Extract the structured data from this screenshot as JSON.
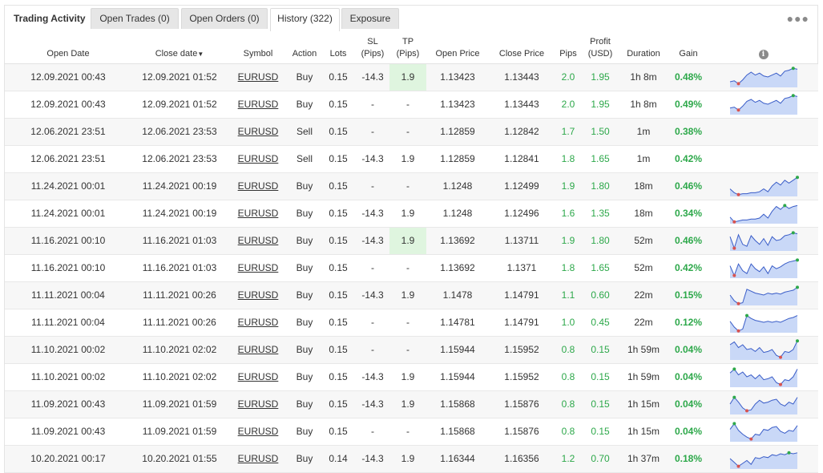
{
  "tabs": {
    "title": "Trading Activity",
    "items": [
      {
        "label": "Open Trades (0)"
      },
      {
        "label": "Open Orders (0)"
      },
      {
        "label": "History (322)"
      },
      {
        "label": "Exposure"
      }
    ],
    "active_index": 2
  },
  "more_icon": "ellipsis-icon",
  "columns": {
    "open_date": "Open Date",
    "close_date": "Close date",
    "sort_arrow": "▼",
    "symbol": "Symbol",
    "action": "Action",
    "lots": "Lots",
    "sl_1": "SL",
    "sl_2": "(Pips)",
    "tp_1": "TP",
    "tp_2": "(Pips)",
    "open_price": "Open Price",
    "close_price": "Close Price",
    "pips": "Pips",
    "profit_1": "Profit",
    "profit_2": "(USD)",
    "duration": "Duration",
    "gain": "Gain",
    "info": "i"
  },
  "colors": {
    "positive": "#2da84a",
    "tp_highlight": "#dff5df",
    "spark_fill": "#c9d8f7",
    "spark_line": "#3a5dc8",
    "spark_max": "#2da84a",
    "spark_min": "#d9534f"
  },
  "rows": [
    {
      "open_date": "12.09.2021 00:43",
      "close_date": "12.09.2021 01:52",
      "symbol": "EURUSD",
      "action": "Buy",
      "lots": "0.15",
      "sl": "-14.3",
      "tp": "1.9",
      "tp_hit": true,
      "open_price": "1.13423",
      "close_price": "1.13443",
      "pips": "2.0",
      "profit": "1.95",
      "duration": "1h 8m",
      "gain": "0.48%",
      "spark": [
        0.25,
        0.3,
        0.15,
        0.35,
        0.6,
        0.75,
        0.6,
        0.7,
        0.55,
        0.5,
        0.6,
        0.7,
        0.55,
        0.8,
        0.85,
        0.95,
        0.9
      ]
    },
    {
      "open_date": "12.09.2021 00:43",
      "close_date": "12.09.2021 01:52",
      "symbol": "EURUSD",
      "action": "Buy",
      "lots": "0.15",
      "sl": "-",
      "tp": "-",
      "tp_hit": false,
      "open_price": "1.13423",
      "close_price": "1.13443",
      "pips": "2.0",
      "profit": "1.95",
      "duration": "1h 8m",
      "gain": "0.49%",
      "spark": [
        0.3,
        0.35,
        0.2,
        0.4,
        0.65,
        0.75,
        0.6,
        0.7,
        0.55,
        0.5,
        0.6,
        0.7,
        0.55,
        0.8,
        0.85,
        0.95,
        0.9
      ]
    },
    {
      "open_date": "12.06.2021 23:51",
      "close_date": "12.06.2021 23:53",
      "symbol": "EURUSD",
      "action": "Sell",
      "lots": "0.15",
      "sl": "-",
      "tp": "-",
      "tp_hit": false,
      "open_price": "1.12859",
      "close_price": "1.12842",
      "pips": "1.7",
      "profit": "1.50",
      "duration": "1m",
      "gain": "0.38%",
      "spark": []
    },
    {
      "open_date": "12.06.2021 23:51",
      "close_date": "12.06.2021 23:53",
      "symbol": "EURUSD",
      "action": "Sell",
      "lots": "0.15",
      "sl": "-14.3",
      "tp": "1.9",
      "tp_hit": false,
      "open_price": "1.12859",
      "close_price": "1.12841",
      "pips": "1.8",
      "profit": "1.65",
      "duration": "1m",
      "gain": "0.42%",
      "spark": []
    },
    {
      "open_date": "11.24.2021 00:01",
      "close_date": "11.24.2021 00:19",
      "symbol": "EURUSD",
      "action": "Buy",
      "lots": "0.15",
      "sl": "-",
      "tp": "-",
      "tp_hit": false,
      "open_price": "1.1248",
      "close_price": "1.12499",
      "pips": "1.9",
      "profit": "1.80",
      "duration": "18m",
      "gain": "0.46%",
      "spark": [
        0.35,
        0.15,
        0.05,
        0.1,
        0.1,
        0.15,
        0.15,
        0.2,
        0.35,
        0.2,
        0.5,
        0.7,
        0.55,
        0.8,
        0.65,
        0.8,
        0.95
      ]
    },
    {
      "open_date": "11.24.2021 00:01",
      "close_date": "11.24.2021 00:19",
      "symbol": "EURUSD",
      "action": "Buy",
      "lots": "0.15",
      "sl": "-14.3",
      "tp": "1.9",
      "tp_hit": false,
      "open_price": "1.1248",
      "close_price": "1.12496",
      "pips": "1.6",
      "profit": "1.35",
      "duration": "18m",
      "gain": "0.34%",
      "spark": [
        0.3,
        0.05,
        0.1,
        0.15,
        0.15,
        0.2,
        0.2,
        0.25,
        0.45,
        0.25,
        0.6,
        0.85,
        0.7,
        0.9,
        0.75,
        0.85,
        0.9
      ]
    },
    {
      "open_date": "11.16.2021 00:10",
      "close_date": "11.16.2021 01:03",
      "symbol": "EURUSD",
      "action": "Buy",
      "lots": "0.15",
      "sl": "-14.3",
      "tp": "1.9",
      "tp_hit": true,
      "open_price": "1.13692",
      "close_price": "1.13711",
      "pips": "1.9",
      "profit": "1.80",
      "duration": "52m",
      "gain": "0.46%",
      "spark": [
        0.7,
        0.1,
        0.8,
        0.3,
        0.2,
        0.75,
        0.5,
        0.3,
        0.6,
        0.25,
        0.7,
        0.5,
        0.55,
        0.75,
        0.8,
        0.9,
        0.85
      ]
    },
    {
      "open_date": "11.16.2021 00:10",
      "close_date": "11.16.2021 01:03",
      "symbol": "EURUSD",
      "action": "Buy",
      "lots": "0.15",
      "sl": "-",
      "tp": "-",
      "tp_hit": false,
      "open_price": "1.13692",
      "close_price": "1.1371",
      "pips": "1.8",
      "profit": "1.65",
      "duration": "52m",
      "gain": "0.42%",
      "spark": [
        0.6,
        0.1,
        0.7,
        0.35,
        0.2,
        0.7,
        0.45,
        0.3,
        0.55,
        0.2,
        0.6,
        0.45,
        0.55,
        0.7,
        0.8,
        0.85,
        0.9
      ]
    },
    {
      "open_date": "11.11.2021 00:04",
      "close_date": "11.11.2021 00:26",
      "symbol": "EURUSD",
      "action": "Buy",
      "lots": "0.15",
      "sl": "-14.3",
      "tp": "1.9",
      "tp_hit": false,
      "open_price": "1.1478",
      "close_price": "1.14791",
      "pips": "1.1",
      "profit": "0.60",
      "duration": "22m",
      "gain": "0.15%",
      "spark": [
        0.5,
        0.2,
        0.05,
        0.1,
        0.8,
        0.7,
        0.6,
        0.55,
        0.5,
        0.6,
        0.55,
        0.6,
        0.55,
        0.65,
        0.7,
        0.75,
        0.9
      ]
    },
    {
      "open_date": "11.11.2021 00:04",
      "close_date": "11.11.2021 00:26",
      "symbol": "EURUSD",
      "action": "Buy",
      "lots": "0.15",
      "sl": "-",
      "tp": "-",
      "tp_hit": false,
      "open_price": "1.14781",
      "close_price": "1.14791",
      "pips": "1.0",
      "profit": "0.45",
      "duration": "22m",
      "gain": "0.12%",
      "spark": [
        0.55,
        0.25,
        0.05,
        0.15,
        0.85,
        0.7,
        0.6,
        0.55,
        0.5,
        0.55,
        0.5,
        0.55,
        0.5,
        0.6,
        0.7,
        0.75,
        0.85
      ]
    },
    {
      "open_date": "11.10.2021 00:02",
      "close_date": "11.10.2021 02:02",
      "symbol": "EURUSD",
      "action": "Buy",
      "lots": "0.15",
      "sl": "-",
      "tp": "-",
      "tp_hit": false,
      "open_price": "1.15944",
      "close_price": "1.15952",
      "pips": "0.8",
      "profit": "0.15",
      "duration": "1h 59m",
      "gain": "0.04%",
      "spark": [
        0.75,
        0.9,
        0.6,
        0.75,
        0.5,
        0.55,
        0.4,
        0.6,
        0.35,
        0.4,
        0.5,
        0.2,
        0.1,
        0.4,
        0.35,
        0.5,
        0.95
      ]
    },
    {
      "open_date": "11.10.2021 00:02",
      "close_date": "11.10.2021 02:02",
      "symbol": "EURUSD",
      "action": "Buy",
      "lots": "0.15",
      "sl": "-14.3",
      "tp": "1.9",
      "tp_hit": false,
      "open_price": "1.15944",
      "close_price": "1.15952",
      "pips": "0.8",
      "profit": "0.15",
      "duration": "1h 59m",
      "gain": "0.04%",
      "spark": [
        0.7,
        0.9,
        0.6,
        0.75,
        0.5,
        0.6,
        0.4,
        0.6,
        0.35,
        0.4,
        0.5,
        0.2,
        0.1,
        0.35,
        0.3,
        0.5,
        0.9
      ]
    },
    {
      "open_date": "11.09.2021 00:43",
      "close_date": "11.09.2021 01:59",
      "symbol": "EURUSD",
      "action": "Buy",
      "lots": "0.15",
      "sl": "-14.3",
      "tp": "1.9",
      "tp_hit": false,
      "open_price": "1.15868",
      "close_price": "1.15876",
      "pips": "0.8",
      "profit": "0.15",
      "duration": "1h 15m",
      "gain": "0.04%",
      "spark": [
        0.5,
        0.85,
        0.6,
        0.3,
        0.15,
        0.2,
        0.5,
        0.7,
        0.55,
        0.6,
        0.7,
        0.75,
        0.5,
        0.4,
        0.6,
        0.5,
        0.85
      ]
    },
    {
      "open_date": "11.09.2021 00:43",
      "close_date": "11.09.2021 01:59",
      "symbol": "EURUSD",
      "action": "Buy",
      "lots": "0.15",
      "sl": "-",
      "tp": "-",
      "tp_hit": false,
      "open_price": "1.15868",
      "close_price": "1.15876",
      "pips": "0.8",
      "profit": "0.15",
      "duration": "1h 15m",
      "gain": "0.04%",
      "spark": [
        0.6,
        0.9,
        0.55,
        0.35,
        0.2,
        0.1,
        0.35,
        0.3,
        0.6,
        0.55,
        0.7,
        0.75,
        0.5,
        0.4,
        0.55,
        0.5,
        0.8
      ]
    },
    {
      "open_date": "10.20.2021 00:17",
      "close_date": "10.20.2021 01:55",
      "symbol": "EURUSD",
      "action": "Buy",
      "lots": "0.14",
      "sl": "-14.3",
      "tp": "1.9",
      "tp_hit": false,
      "open_price": "1.16344",
      "close_price": "1.16356",
      "pips": "1.2",
      "profit": "0.70",
      "duration": "1h 37m",
      "gain": "0.18%",
      "spark": [
        0.5,
        0.3,
        0.1,
        0.25,
        0.4,
        0.2,
        0.55,
        0.5,
        0.6,
        0.55,
        0.7,
        0.65,
        0.75,
        0.7,
        0.8,
        0.75,
        0.8
      ]
    }
  ]
}
